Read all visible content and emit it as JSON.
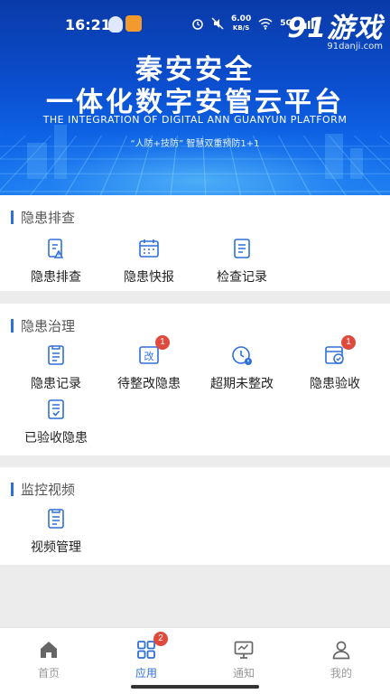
{
  "status_bar": {
    "time": "16:21",
    "speed_value": "6.00",
    "speed_unit": "KB/S",
    "network": "5G",
    "watermark_main": "91游戏",
    "watermark_sub": "91danji.com"
  },
  "banner": {
    "title_line1": "秦安安全",
    "title_line2": "一体化数字安管云平台",
    "subtitle_en": "THE INTEGRATION OF DIGITAL ANN GUANYUN PLATFORM",
    "slogan": "“人防+技防” 智慧双重预防1+1"
  },
  "sections": [
    {
      "title": "隐患排查",
      "items": [
        {
          "label": "隐患排查",
          "icon": "hazard-check-icon"
        },
        {
          "label": "隐患快报",
          "icon": "calendar-report-icon"
        },
        {
          "label": "检查记录",
          "icon": "checklist-icon"
        }
      ]
    },
    {
      "title": "隐患治理",
      "items": [
        {
          "label": "隐患记录",
          "icon": "record-icon",
          "badge": ""
        },
        {
          "label": "待整改隐患",
          "icon": "rectify-icon",
          "badge": "1"
        },
        {
          "label": "超期未整改",
          "icon": "overdue-clock-icon",
          "badge": ""
        },
        {
          "label": "隐患验收",
          "icon": "acceptance-icon",
          "badge": "1"
        },
        {
          "label": "已验收隐患",
          "icon": "accepted-icon",
          "badge": ""
        }
      ]
    },
    {
      "title": "监控视频",
      "items": [
        {
          "label": "视频管理",
          "icon": "video-manage-icon"
        }
      ]
    }
  ],
  "tabbar": {
    "tabs": [
      {
        "label": "首页",
        "icon": "home-icon",
        "active": false
      },
      {
        "label": "应用",
        "icon": "apps-grid-icon",
        "active": true,
        "badge": "2"
      },
      {
        "label": "通知",
        "icon": "monitor-icon",
        "active": false
      },
      {
        "label": "我的",
        "icon": "user-icon",
        "active": false
      }
    ]
  },
  "colors": {
    "accent": "#2f6fd8",
    "badge": "#e04a3d",
    "banner": "#0b4fd0"
  }
}
